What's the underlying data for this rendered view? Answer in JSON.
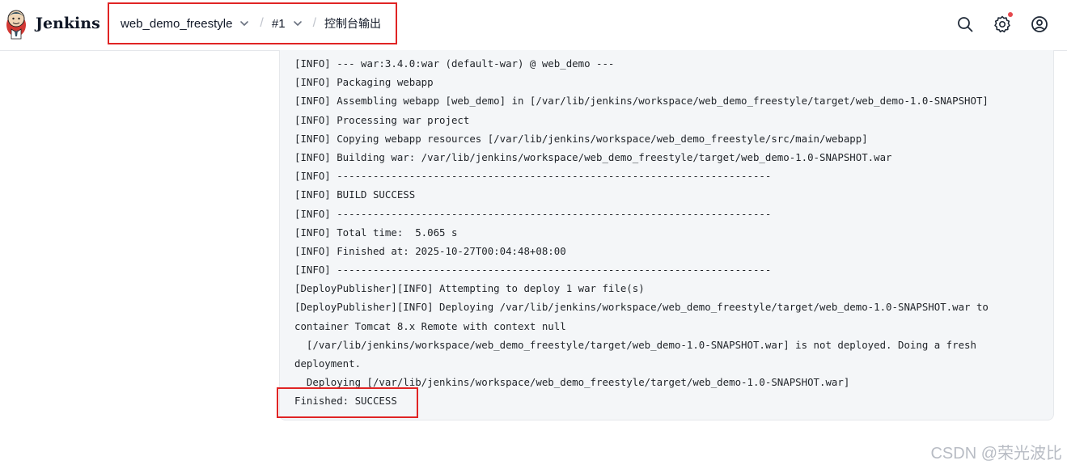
{
  "header": {
    "brand": "Jenkins",
    "breadcrumb": {
      "job": "web_demo_freestyle",
      "build": "#1",
      "page": "控制台输出",
      "separator": "/"
    }
  },
  "console": {
    "lines": [
      "[INFO] --- war:3.4.0:war (default-war) @ web_demo ---",
      "[INFO] Packaging webapp",
      "[INFO] Assembling webapp [web_demo] in [/var/lib/jenkins/workspace/web_demo_freestyle/target/web_demo-1.0-SNAPSHOT]",
      "[INFO] Processing war project",
      "[INFO] Copying webapp resources [/var/lib/jenkins/workspace/web_demo_freestyle/src/main/webapp]",
      "[INFO] Building war: /var/lib/jenkins/workspace/web_demo_freestyle/target/web_demo-1.0-SNAPSHOT.war",
      "[INFO] ------------------------------------------------------------------------",
      "[INFO] BUILD SUCCESS",
      "[INFO] ------------------------------------------------------------------------",
      "[INFO] Total time:  5.065 s",
      "[INFO] Finished at: 2025-10-27T00:04:48+08:00",
      "[INFO] ------------------------------------------------------------------------",
      "[DeployPublisher][INFO] Attempting to deploy 1 war file(s)",
      "[DeployPublisher][INFO] Deploying /var/lib/jenkins/workspace/web_demo_freestyle/target/web_demo-1.0-SNAPSHOT.war to",
      "container Tomcat 8.x Remote with context null",
      "  [/var/lib/jenkins/workspace/web_demo_freestyle/target/web_demo-1.0-SNAPSHOT.war] is not deployed. Doing a fresh",
      "deployment.",
      "  Deploying [/var/lib/jenkins/workspace/web_demo_freestyle/target/web_demo-1.0-SNAPSHOT.war]",
      "Finished: SUCCESS"
    ]
  },
  "watermark": "CSDN @荣光波比",
  "colors": {
    "highlight": "#e02424",
    "console_bg": "#f4f6f8",
    "notification_dot": "#e5484d"
  },
  "icons": {
    "logo": "jenkins-butler-logo",
    "search": "search-icon",
    "settings": "gear-icon",
    "account": "user-circle-icon"
  }
}
